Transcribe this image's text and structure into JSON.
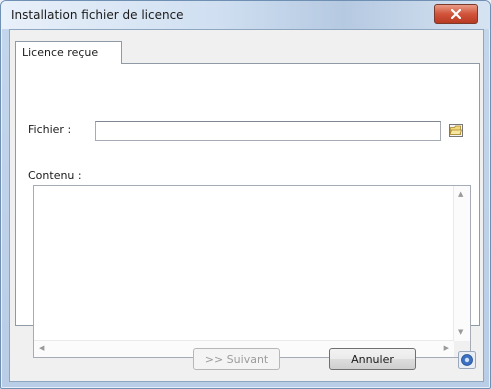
{
  "window": {
    "title": "Installation fichier de licence"
  },
  "tabs": [
    {
      "label": "Licence reçue"
    }
  ],
  "form": {
    "file_label": "Fichier :",
    "file_value": "",
    "content_label": "Contenu :",
    "content_value": ""
  },
  "buttons": {
    "next_label": ">> Suivant",
    "cancel_label": "Annuler"
  },
  "icons": {
    "close": "close-icon",
    "browse": "folder-open-icon",
    "help": "help-icon"
  },
  "colors": {
    "close_button": "#d0533a",
    "help_icon": "#3a6fc4"
  }
}
